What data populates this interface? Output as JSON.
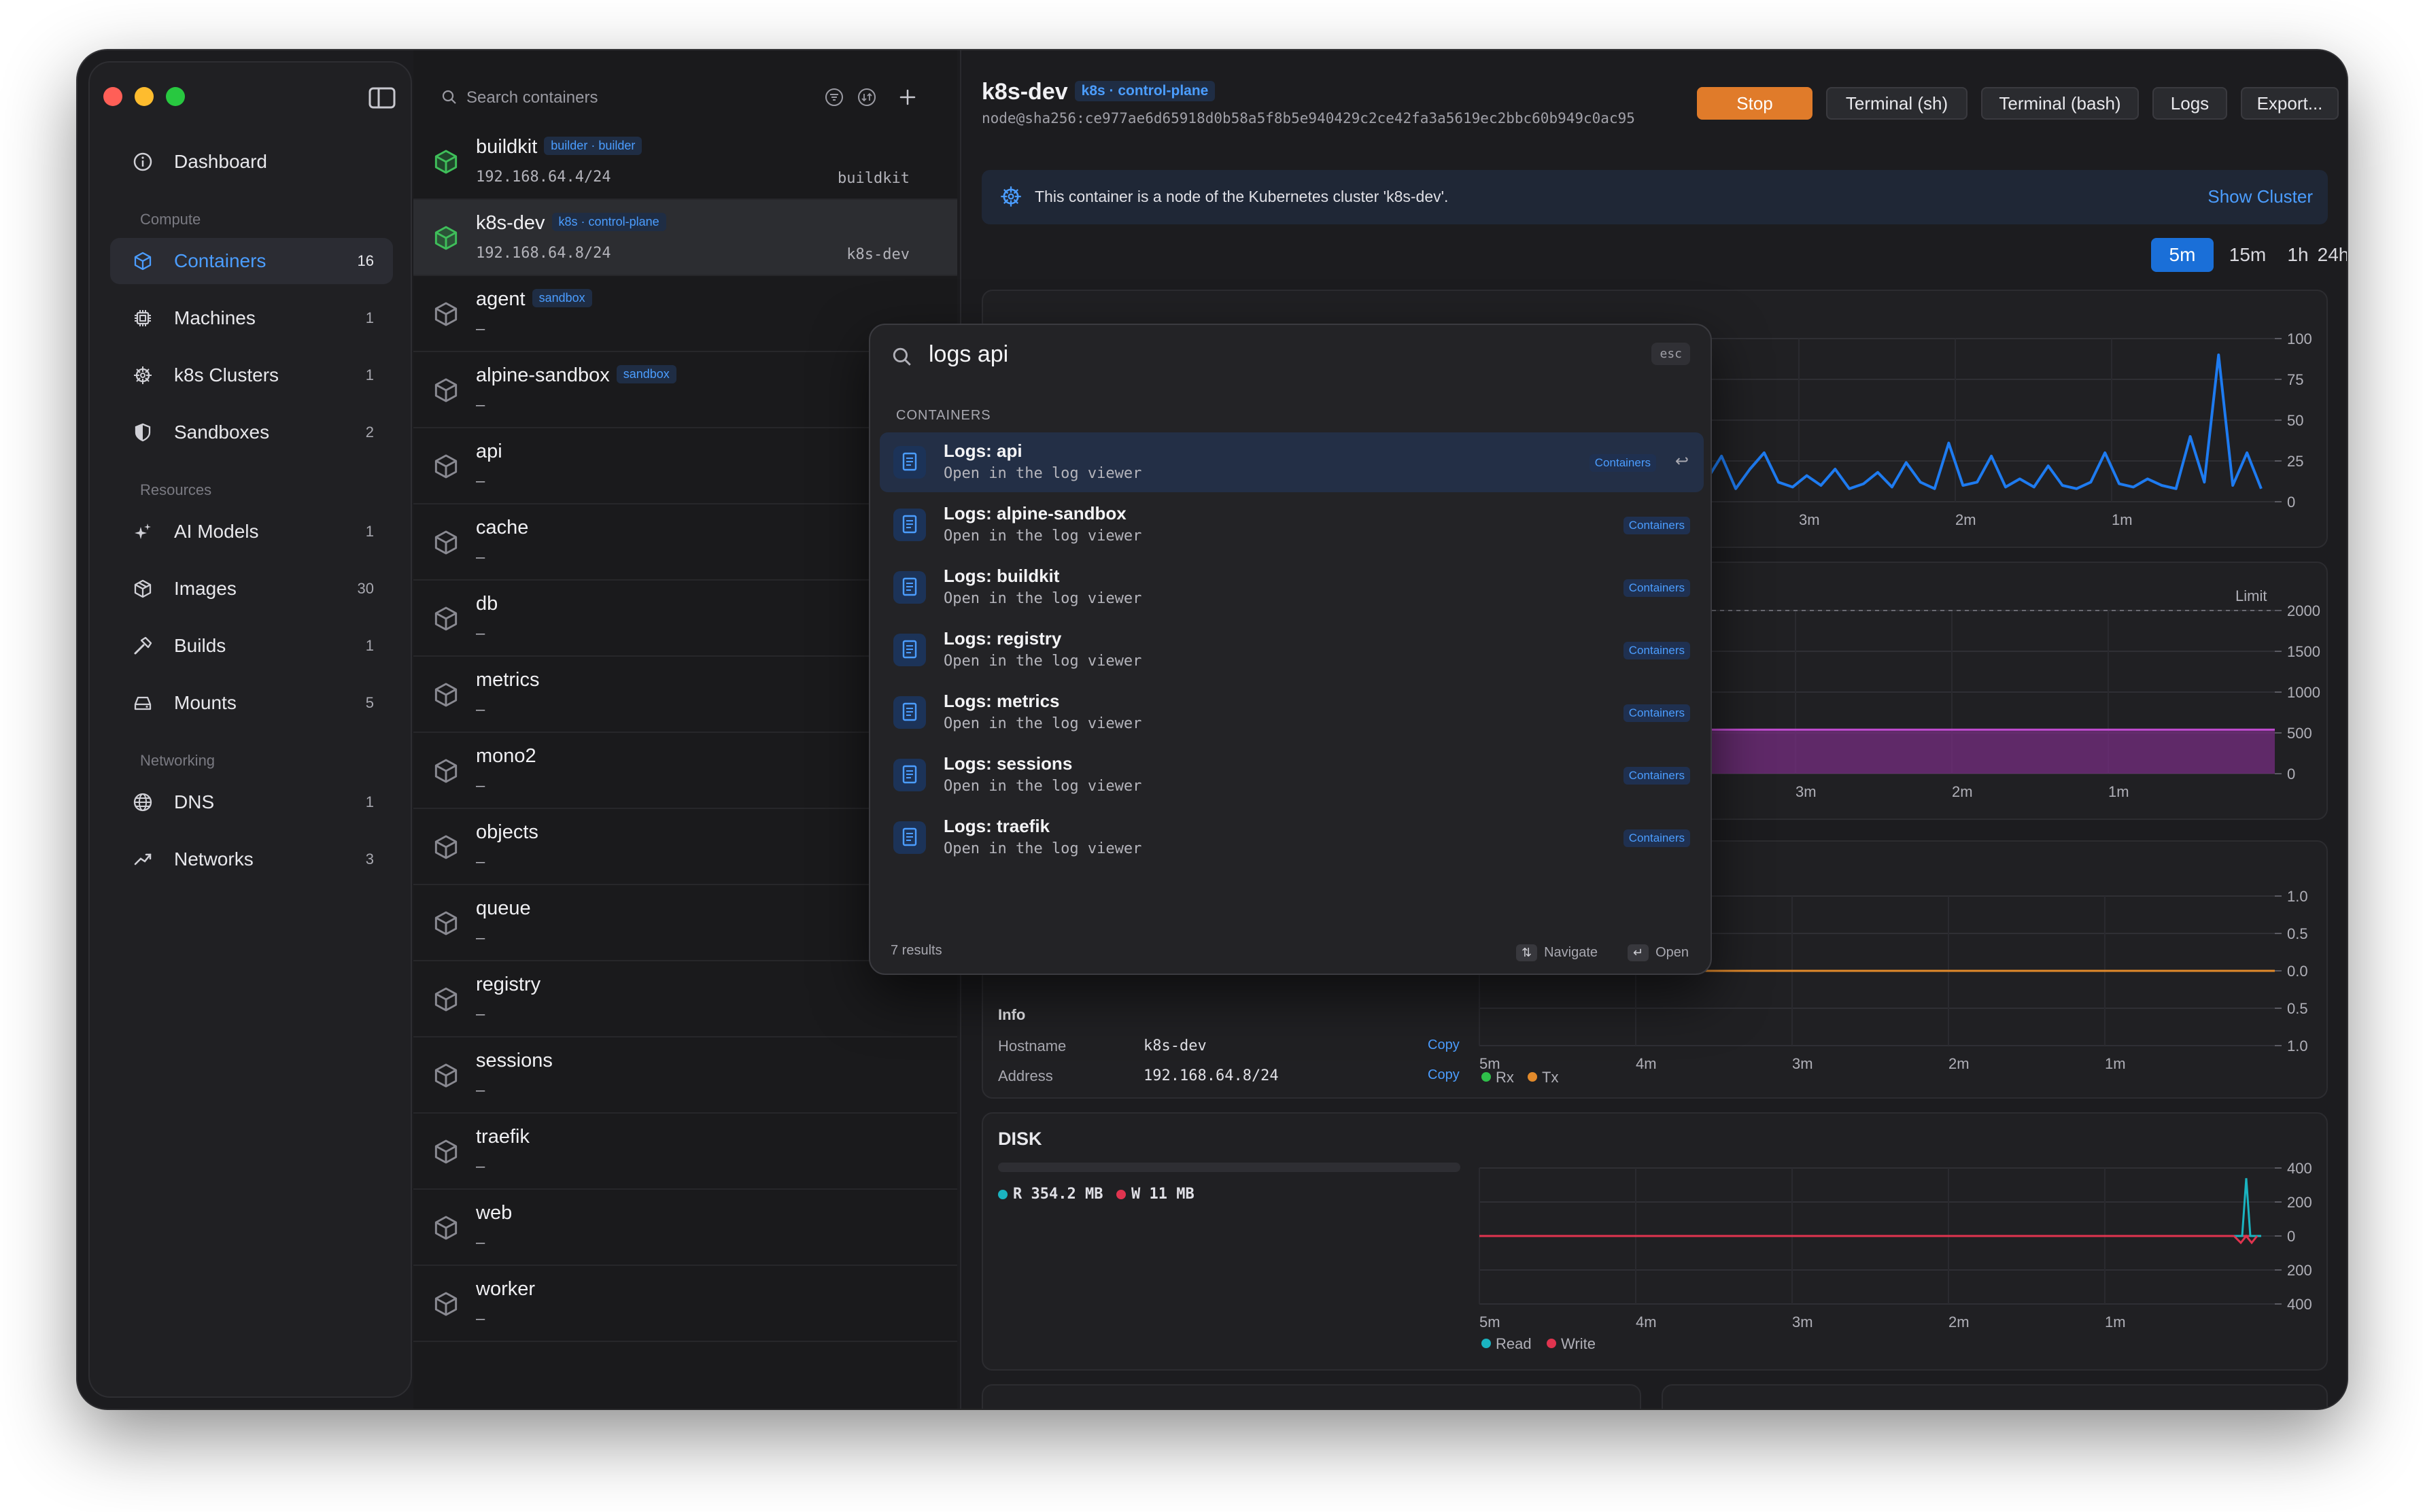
{
  "sidebar": {
    "items": [
      {
        "label": "Dashboard",
        "count": ""
      },
      {
        "label": "Containers",
        "count": "16"
      },
      {
        "label": "Machines",
        "count": "1"
      },
      {
        "label": "k8s Clusters",
        "count": "1"
      },
      {
        "label": "Sandboxes",
        "count": "2"
      },
      {
        "label": "AI Models",
        "count": "1"
      },
      {
        "label": "Images",
        "count": "30"
      },
      {
        "label": "Builds",
        "count": "1"
      },
      {
        "label": "Mounts",
        "count": "5"
      },
      {
        "label": "DNS",
        "count": "1"
      },
      {
        "label": "Networks",
        "count": "3"
      }
    ],
    "sections": {
      "compute": "Compute",
      "resources": "Resources",
      "networking": "Networking"
    }
  },
  "containers": {
    "search_placeholder": "Search containers",
    "items": [
      {
        "name": "buildkit",
        "tag": "builder · builder",
        "sub": "192.168.64.4/24",
        "right": "buildkit",
        "running": true
      },
      {
        "name": "k8s-dev",
        "tag": "k8s · control-plane",
        "sub": "192.168.64.8/24",
        "right": "k8s-dev",
        "running": true
      },
      {
        "name": "agent",
        "tag": "sandbox",
        "sub": "–",
        "right": ""
      },
      {
        "name": "alpine-sandbox",
        "tag": "sandbox",
        "sub": "–",
        "right": ""
      },
      {
        "name": "api",
        "tag": "",
        "sub": "–",
        "right": ""
      },
      {
        "name": "cache",
        "tag": "",
        "sub": "–",
        "right": ""
      },
      {
        "name": "db",
        "tag": "",
        "sub": "–",
        "right": ""
      },
      {
        "name": "metrics",
        "tag": "",
        "sub": "–",
        "right": ""
      },
      {
        "name": "mono2",
        "tag": "",
        "sub": "–",
        "right": ""
      },
      {
        "name": "objects",
        "tag": "",
        "sub": "–",
        "right": ""
      },
      {
        "name": "queue",
        "tag": "",
        "sub": "–",
        "right": ""
      },
      {
        "name": "registry",
        "tag": "",
        "sub": "–",
        "right": ""
      },
      {
        "name": "sessions",
        "tag": "",
        "sub": "–",
        "right": ""
      },
      {
        "name": "traefik",
        "tag": "",
        "sub": "–",
        "right": ""
      },
      {
        "name": "web",
        "tag": "",
        "sub": "–",
        "right": ""
      },
      {
        "name": "worker",
        "tag": "",
        "sub": "–",
        "right": ""
      }
    ]
  },
  "detail": {
    "title": "k8s-dev",
    "tag": "k8s · control-plane",
    "hash": "node@sha256:ce977ae6d65918d0b58a5f8b5e940429c2ce42fa3a5619ec2bbc60b949c0ac95",
    "buttons": {
      "stop": "Stop",
      "terminal_sh": "Terminal (sh)",
      "terminal_bash": "Terminal (bash)",
      "logs": "Logs",
      "export": "Export..."
    },
    "banner": {
      "text": "This container is a node of the Kubernetes cluster 'k8s-dev'.",
      "link": "Show Cluster"
    },
    "ranges": [
      "5m",
      "15m",
      "1h",
      "24h"
    ],
    "active_range": "5m",
    "info": {
      "title": "Info",
      "hostname_label": "Hostname",
      "hostname": "k8s-dev",
      "address_label": "Address",
      "address": "192.168.64.8/24",
      "copy": "Copy"
    },
    "disk": {
      "title": "DISK",
      "read": "R 354.2 MB",
      "write": "W 11 MB"
    }
  },
  "chart_data": [
    {
      "type": "line",
      "name": "cpu",
      "x": [
        "4m",
        "3m",
        "2m",
        "1m"
      ],
      "ylim": [
        0,
        100
      ],
      "yticks": [
        0,
        25,
        50,
        75,
        100
      ],
      "series": [
        {
          "values": [
            8,
            12,
            6,
            30,
            10,
            62,
            14,
            28,
            8,
            20,
            30,
            12,
            9,
            16,
            10,
            20,
            8,
            11,
            18,
            9,
            24,
            12,
            8,
            36,
            10,
            12,
            28,
            9,
            14,
            9,
            22,
            10,
            8,
            12,
            30,
            11,
            9,
            14,
            10,
            8,
            40,
            12,
            90,
            10,
            30,
            8
          ]
        }
      ]
    },
    {
      "type": "area",
      "name": "memory",
      "x": [
        "4m",
        "3m",
        "2m",
        "1m"
      ],
      "ylim": [
        0,
        2000
      ],
      "yticks": [
        0,
        500,
        1000,
        1500,
        2000
      ],
      "limit_label": "Limit",
      "series": [
        {
          "values": [
            540,
            540,
            540,
            540
          ]
        }
      ]
    },
    {
      "type": "line",
      "name": "network",
      "x": [
        "5m",
        "4m",
        "3m",
        "2m",
        "1m"
      ],
      "yticks": [
        "1.0",
        "0.5",
        "0.0",
        "0.5",
        "1.0"
      ],
      "series": [
        {
          "name": "Rx",
          "values": [
            0,
            0,
            0,
            0,
            0
          ]
        },
        {
          "name": "Tx",
          "values": [
            0,
            0,
            0,
            0,
            0
          ]
        }
      ]
    },
    {
      "type": "line",
      "name": "disk",
      "x": [
        "5m",
        "4m",
        "3m",
        "2m",
        "1m"
      ],
      "yticks": [
        "400",
        "200",
        "0",
        "200",
        "400"
      ],
      "series": [
        {
          "name": "Read",
          "values": [
            0,
            0,
            0,
            0,
            340
          ]
        },
        {
          "name": "Write",
          "values": [
            0,
            0,
            0,
            0,
            -40
          ]
        }
      ]
    }
  ],
  "palette": {
    "query": "logs api",
    "esc": "esc",
    "section": "CONTAINERS",
    "results": [
      {
        "title": "Logs: api",
        "sub": "Open in the log viewer",
        "badge": "Containers"
      },
      {
        "title": "Logs: alpine-sandbox",
        "sub": "Open in the log viewer",
        "badge": "Containers"
      },
      {
        "title": "Logs: buildkit",
        "sub": "Open in the log viewer",
        "badge": "Containers"
      },
      {
        "title": "Logs: registry",
        "sub": "Open in the log viewer",
        "badge": "Containers"
      },
      {
        "title": "Logs: metrics",
        "sub": "Open in the log viewer",
        "badge": "Containers"
      },
      {
        "title": "Logs: sessions",
        "sub": "Open in the log viewer",
        "badge": "Containers"
      },
      {
        "title": "Logs: traefik",
        "sub": "Open in the log viewer",
        "badge": "Containers"
      }
    ],
    "count": "7 results",
    "navigate": "Navigate",
    "open": "Open"
  },
  "colors": {
    "accent": "#1a6fd8",
    "stop": "#e07b2a",
    "cpu_line": "#1e7bf0",
    "memory_fill": "#7a2e86",
    "rx": "#2fbf4a",
    "tx": "#e28a2b",
    "read": "#1ab3c0",
    "write": "#e0344f"
  }
}
